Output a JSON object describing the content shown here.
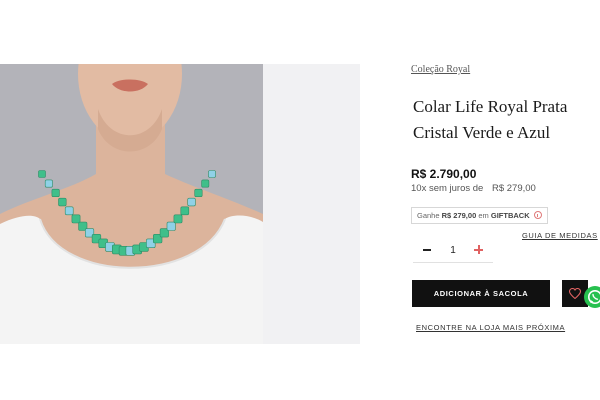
{
  "product": {
    "collection": "Coleção Royal",
    "title_line1": "Colar Life Royal Prata",
    "title_line2": "Cristal Verde e Azul",
    "price": "R$ 2.790,00",
    "installments_label": "10x sem juros de",
    "installments_value": "R$ 279,00",
    "image_alt": "Modelo usando colar de cristais verdes e azuis"
  },
  "giftback": {
    "prefix": "Ganhe",
    "amount": "R$ 279,00",
    "middle": "em",
    "label": "GIFTBACK"
  },
  "actions": {
    "size_guide": "GUIA DE MEDIDAS",
    "quantity": "1",
    "add_to_bag": "ADICIONAR À SACOLA",
    "find_store": "ENCONTRE NA LOJA MAIS PRÓXIMA"
  },
  "icons": {
    "minus": "minus-icon",
    "plus": "plus-icon",
    "wishlist": "heart-icon",
    "whatsapp": "whatsapp-icon",
    "info": "info-icon"
  },
  "colors": {
    "accent": "#e06262",
    "button": "#111111",
    "whatsapp": "#27c04f",
    "gem_green": "#3fbf8a",
    "gem_blue": "#8fd1e6"
  }
}
